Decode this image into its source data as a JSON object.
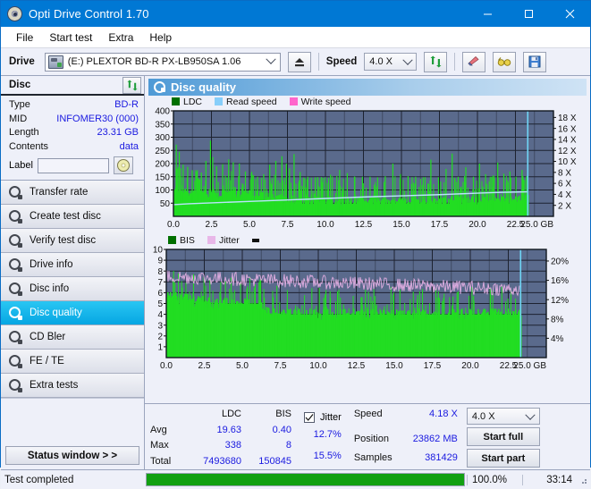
{
  "window": {
    "title": "Opti Drive Control 1.70",
    "icon": "disc-icon",
    "minimize": "–",
    "maximize": "□",
    "close": "✕"
  },
  "menu": [
    "File",
    "Start test",
    "Extra",
    "Help"
  ],
  "toolbar": {
    "drive_label": "Drive",
    "drive_value": "(E:)   PLEXTOR BD-R  PX-LB950SA 1.06",
    "eject_icon": "eject-icon",
    "speed_label": "Speed",
    "speed_value": "4.0 X",
    "refresh_icon": "refresh-icon",
    "erase_icon": "eraser-icon",
    "glasses_icon": "glasses-icon",
    "save_icon": "save-icon"
  },
  "disc": {
    "header": "Disc",
    "refresh_icon": "refresh-icon",
    "rows": [
      {
        "key": "Type",
        "value": "BD-R"
      },
      {
        "key": "MID",
        "value": "INFOMER30 (000)"
      },
      {
        "key": "Length",
        "value": "23.31 GB"
      },
      {
        "key": "Contents",
        "value": "data"
      }
    ],
    "label_key": "Label",
    "label_value": "",
    "label_placeholder": "",
    "disc_button_icon": "disc-icon"
  },
  "nav": {
    "items": [
      {
        "label": "Transfer rate",
        "selected": false
      },
      {
        "label": "Create test disc",
        "selected": false
      },
      {
        "label": "Verify test disc",
        "selected": false
      },
      {
        "label": "Drive info",
        "selected": false
      },
      {
        "label": "Disc info",
        "selected": false
      },
      {
        "label": "Disc quality",
        "selected": true
      },
      {
        "label": "CD Bler",
        "selected": false
      },
      {
        "label": "FE / TE",
        "selected": false
      },
      {
        "label": "Extra tests",
        "selected": false
      }
    ],
    "status_window": "Status window > >"
  },
  "panel": {
    "title": "Disc quality",
    "icon": "disc-quality-icon"
  },
  "chart_data": [
    {
      "type": "area",
      "name": "ldc-chart",
      "title": "",
      "xlabel": "GB",
      "ylabel": "LDC",
      "legend": [
        {
          "label": "LDC",
          "color": "#006f00"
        },
        {
          "label": "Read speed",
          "color": "#87cefa"
        },
        {
          "label": "Write speed",
          "color": "#ff66cc"
        }
      ],
      "legend_position": "top",
      "grid": true,
      "xlim": [
        0.0,
        25.0
      ],
      "xticks": [
        "0.0",
        "2.5",
        "5.0",
        "7.5",
        "10.0",
        "12.5",
        "15.0",
        "17.5",
        "20.0",
        "22.5",
        "25.0 GB"
      ],
      "ylim": [
        0,
        400
      ],
      "yticks": [
        400,
        350,
        300,
        250,
        200,
        150,
        100,
        50
      ],
      "y2lim": [
        0,
        18
      ],
      "y2ticks": [
        "18 X",
        "16 X",
        "14 X",
        "12 X",
        "10 X",
        "8 X",
        "6 X",
        "4 X",
        "2 X"
      ],
      "plot_bg": "#5a6a8c",
      "data_end_gb": 23.31,
      "series": [
        {
          "name": "LDC",
          "color": "#22dd22",
          "type": "spike-area",
          "baseline_x": [
            0.0,
            1.5,
            3.0,
            5.0,
            6.5,
            8.0,
            10.0,
            12.5,
            15.0,
            17.5,
            20.0,
            22.0,
            23.3
          ],
          "baseline_y": [
            95,
            88,
            86,
            84,
            70,
            62,
            60,
            58,
            58,
            60,
            62,
            62,
            68
          ],
          "peak_x": [
            0.15,
            0.35,
            0.6,
            0.9,
            1.2,
            1.5,
            1.8,
            2.1,
            2.4,
            2.55,
            2.8,
            3.2,
            3.6,
            3.9,
            4.3,
            4.7,
            5.1,
            5.5,
            5.9,
            6.3,
            6.7,
            7.1,
            7.4,
            7.6,
            7.9,
            8.3,
            8.8,
            9.3,
            9.8,
            10.3,
            10.9,
            11.4,
            11.9,
            12.4,
            12.9,
            13.4,
            13.9,
            14.4,
            14.9,
            15.4,
            15.9,
            16.4,
            16.9,
            17.4,
            17.9,
            18.3,
            18.7,
            19.2,
            19.7,
            20.1,
            20.5,
            20.9,
            21.3,
            21.7,
            22.1,
            22.5,
            22.9,
            23.2
          ],
          "peak_y": [
            272,
            245,
            196,
            188,
            175,
            170,
            166,
            210,
            287,
            225,
            190,
            198,
            216,
            205,
            200,
            170,
            164,
            150,
            160,
            196,
            210,
            228,
            200,
            182,
            236,
            168,
            150,
            148,
            146,
            158,
            176,
            164,
            150,
            150,
            150,
            148,
            152,
            200,
            160,
            152,
            150,
            148,
            215,
            148,
            180,
            238,
            150,
            186,
            150,
            200,
            160,
            150,
            204,
            162,
            170,
            150,
            176,
            152
          ]
        },
        {
          "name": "Read speed",
          "color": "#b9e4fb",
          "type": "line",
          "x": [
            0.0,
            1.0,
            2.5,
            5.0,
            7.5,
            10.0,
            12.5,
            15.0,
            17.5,
            19.0,
            20.0,
            21.0,
            22.0,
            23.3
          ],
          "y_speed": [
            2.0,
            2.15,
            2.3,
            2.55,
            2.8,
            3.05,
            3.3,
            3.5,
            3.7,
            3.85,
            3.95,
            4.05,
            4.12,
            4.18
          ]
        }
      ]
    },
    {
      "type": "area",
      "name": "bis-chart",
      "title": "",
      "xlabel": "GB",
      "ylabel": "BIS",
      "legend": [
        {
          "label": "BIS",
          "color": "#006f00"
        },
        {
          "label": "Jitter",
          "color": "#e8b7e8"
        }
      ],
      "legend_position": "top",
      "grid": true,
      "xlim": [
        0.0,
        25.0
      ],
      "xticks": [
        "0.0",
        "2.5",
        "5.0",
        "7.5",
        "10.0",
        "12.5",
        "15.0",
        "17.5",
        "20.0",
        "22.5",
        "25.0 GB"
      ],
      "ylim": [
        0,
        10
      ],
      "yticks": [
        10,
        9,
        8,
        7,
        6,
        5,
        4,
        3,
        2,
        1
      ],
      "y2lim": [
        0,
        20
      ],
      "y2ticks": [
        "20%",
        "16%",
        "12%",
        "8%",
        "4%"
      ],
      "plot_bg": "#5a6a8c",
      "data_end_gb": 23.31,
      "series": [
        {
          "name": "BIS",
          "color": "#22dd22",
          "type": "spike-area",
          "baseline_x": [
            0.0,
            1.0,
            2.0,
            4.0,
            6.0,
            6.6,
            8.0,
            10.0,
            12.0,
            14.0,
            16.0,
            18.0,
            20.0,
            22.0,
            23.3
          ],
          "baseline_y": [
            5.6,
            5.4,
            5.2,
            5.0,
            5.0,
            4.1,
            4.0,
            4.0,
            4.0,
            4.0,
            4.0,
            4.0,
            4.0,
            4.0,
            4.0
          ]
        },
        {
          "name": "Jitter",
          "color": "#e2aee2",
          "type": "line",
          "avg": 6.6,
          "band": 0.8,
          "start": 7.5,
          "end": 6.3
        }
      ]
    }
  ],
  "results": {
    "col_headers": [
      "LDC",
      "BIS"
    ],
    "rows": [
      {
        "key": "Avg",
        "ldc": "19.63",
        "bis": "0.40",
        "jitter": "12.7%"
      },
      {
        "key": "Max",
        "ldc": "338",
        "bis": "8",
        "jitter": "15.5%"
      },
      {
        "key": "Total",
        "ldc": "7493680",
        "bis": "150845",
        "jitter": ""
      }
    ],
    "jitter_label": "Jitter",
    "jitter_checked": true,
    "speed_key": "Speed",
    "speed_value": "4.18 X",
    "position_key": "Position",
    "position_value": "23862 MB",
    "samples_key": "Samples",
    "samples_value": "381429",
    "speed_select": "4.0 X",
    "start_full": "Start full",
    "start_part": "Start part"
  },
  "statusbar": {
    "text": "Test completed",
    "progress_percent": 100,
    "percent_label": "100.0%",
    "time": "33:14"
  }
}
